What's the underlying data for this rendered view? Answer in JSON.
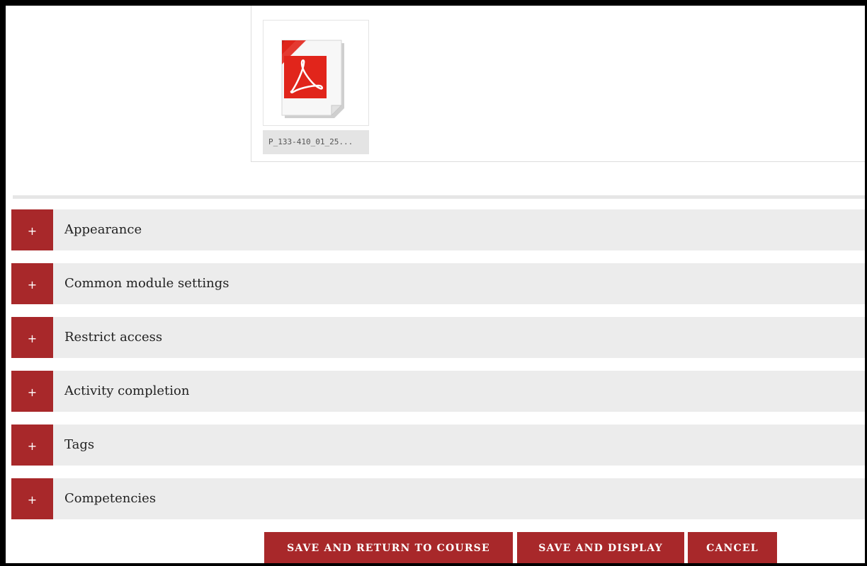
{
  "file": {
    "name": "P_133-410_01_25...",
    "icon": "pdf-file-icon"
  },
  "sections": [
    {
      "toggle": "+",
      "label": "Appearance"
    },
    {
      "toggle": "+",
      "label": "Common module settings"
    },
    {
      "toggle": "+",
      "label": "Restrict access"
    },
    {
      "toggle": "+",
      "label": "Activity completion"
    },
    {
      "toggle": "+",
      "label": "Tags"
    },
    {
      "toggle": "+",
      "label": "Competencies"
    }
  ],
  "actions": {
    "save_return": "SAVE AND RETURN TO COURSE",
    "save_display": "SAVE AND DISPLAY",
    "cancel": "CANCEL"
  },
  "colors": {
    "accent": "#a8282a",
    "section_bg": "#ececec",
    "pdf_red": "#e1251b"
  }
}
